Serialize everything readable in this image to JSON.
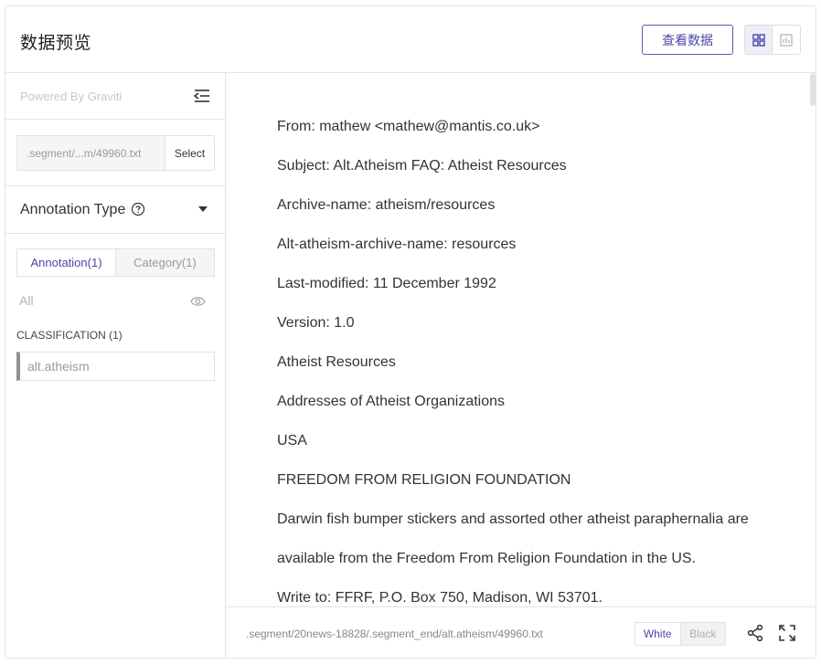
{
  "header": {
    "title": "数据预览",
    "view_data_label": "查看数据",
    "toggle_icons": [
      "grid-icon",
      "bar-chart-icon"
    ]
  },
  "sidebar": {
    "powered_by": "Powered By Graviti",
    "segment_value": ".segment/...m/49960.txt",
    "select_label": "Select",
    "annotation_type_label": "Annotation Type",
    "tabs": [
      {
        "label": "Annotation(1)",
        "active": true
      },
      {
        "label": "Category(1)",
        "active": false
      }
    ],
    "all_label": "All",
    "classification_title": "CLASSIFICATION (1)",
    "classification_items": [
      "alt.atheism"
    ]
  },
  "content": {
    "lines": [
      "From: mathew <mathew@mantis.co.uk>",
      "Subject: Alt.Atheism FAQ: Atheist Resources",
      "Archive-name: atheism/resources",
      "Alt-atheism-archive-name: resources",
      "Last-modified: 11 December 1992",
      "Version: 1.0",
      "Atheist Resources",
      "Addresses of Atheist Organizations",
      "USA",
      "FREEDOM FROM RELIGION FOUNDATION",
      "Darwin fish bumper stickers and assorted other atheist paraphernalia are",
      "available from the Freedom From Religion Foundation in the US.",
      "Write to: FFRF, P.O. Box 750, Madison, WI 53701."
    ]
  },
  "footer": {
    "path": ".segment/20news-18828/.segment_end/alt.atheism/49960.txt",
    "white_label": "White",
    "black_label": "Black"
  },
  "colors": {
    "accent": "#4c46a8",
    "border": "#e4e4e8"
  }
}
